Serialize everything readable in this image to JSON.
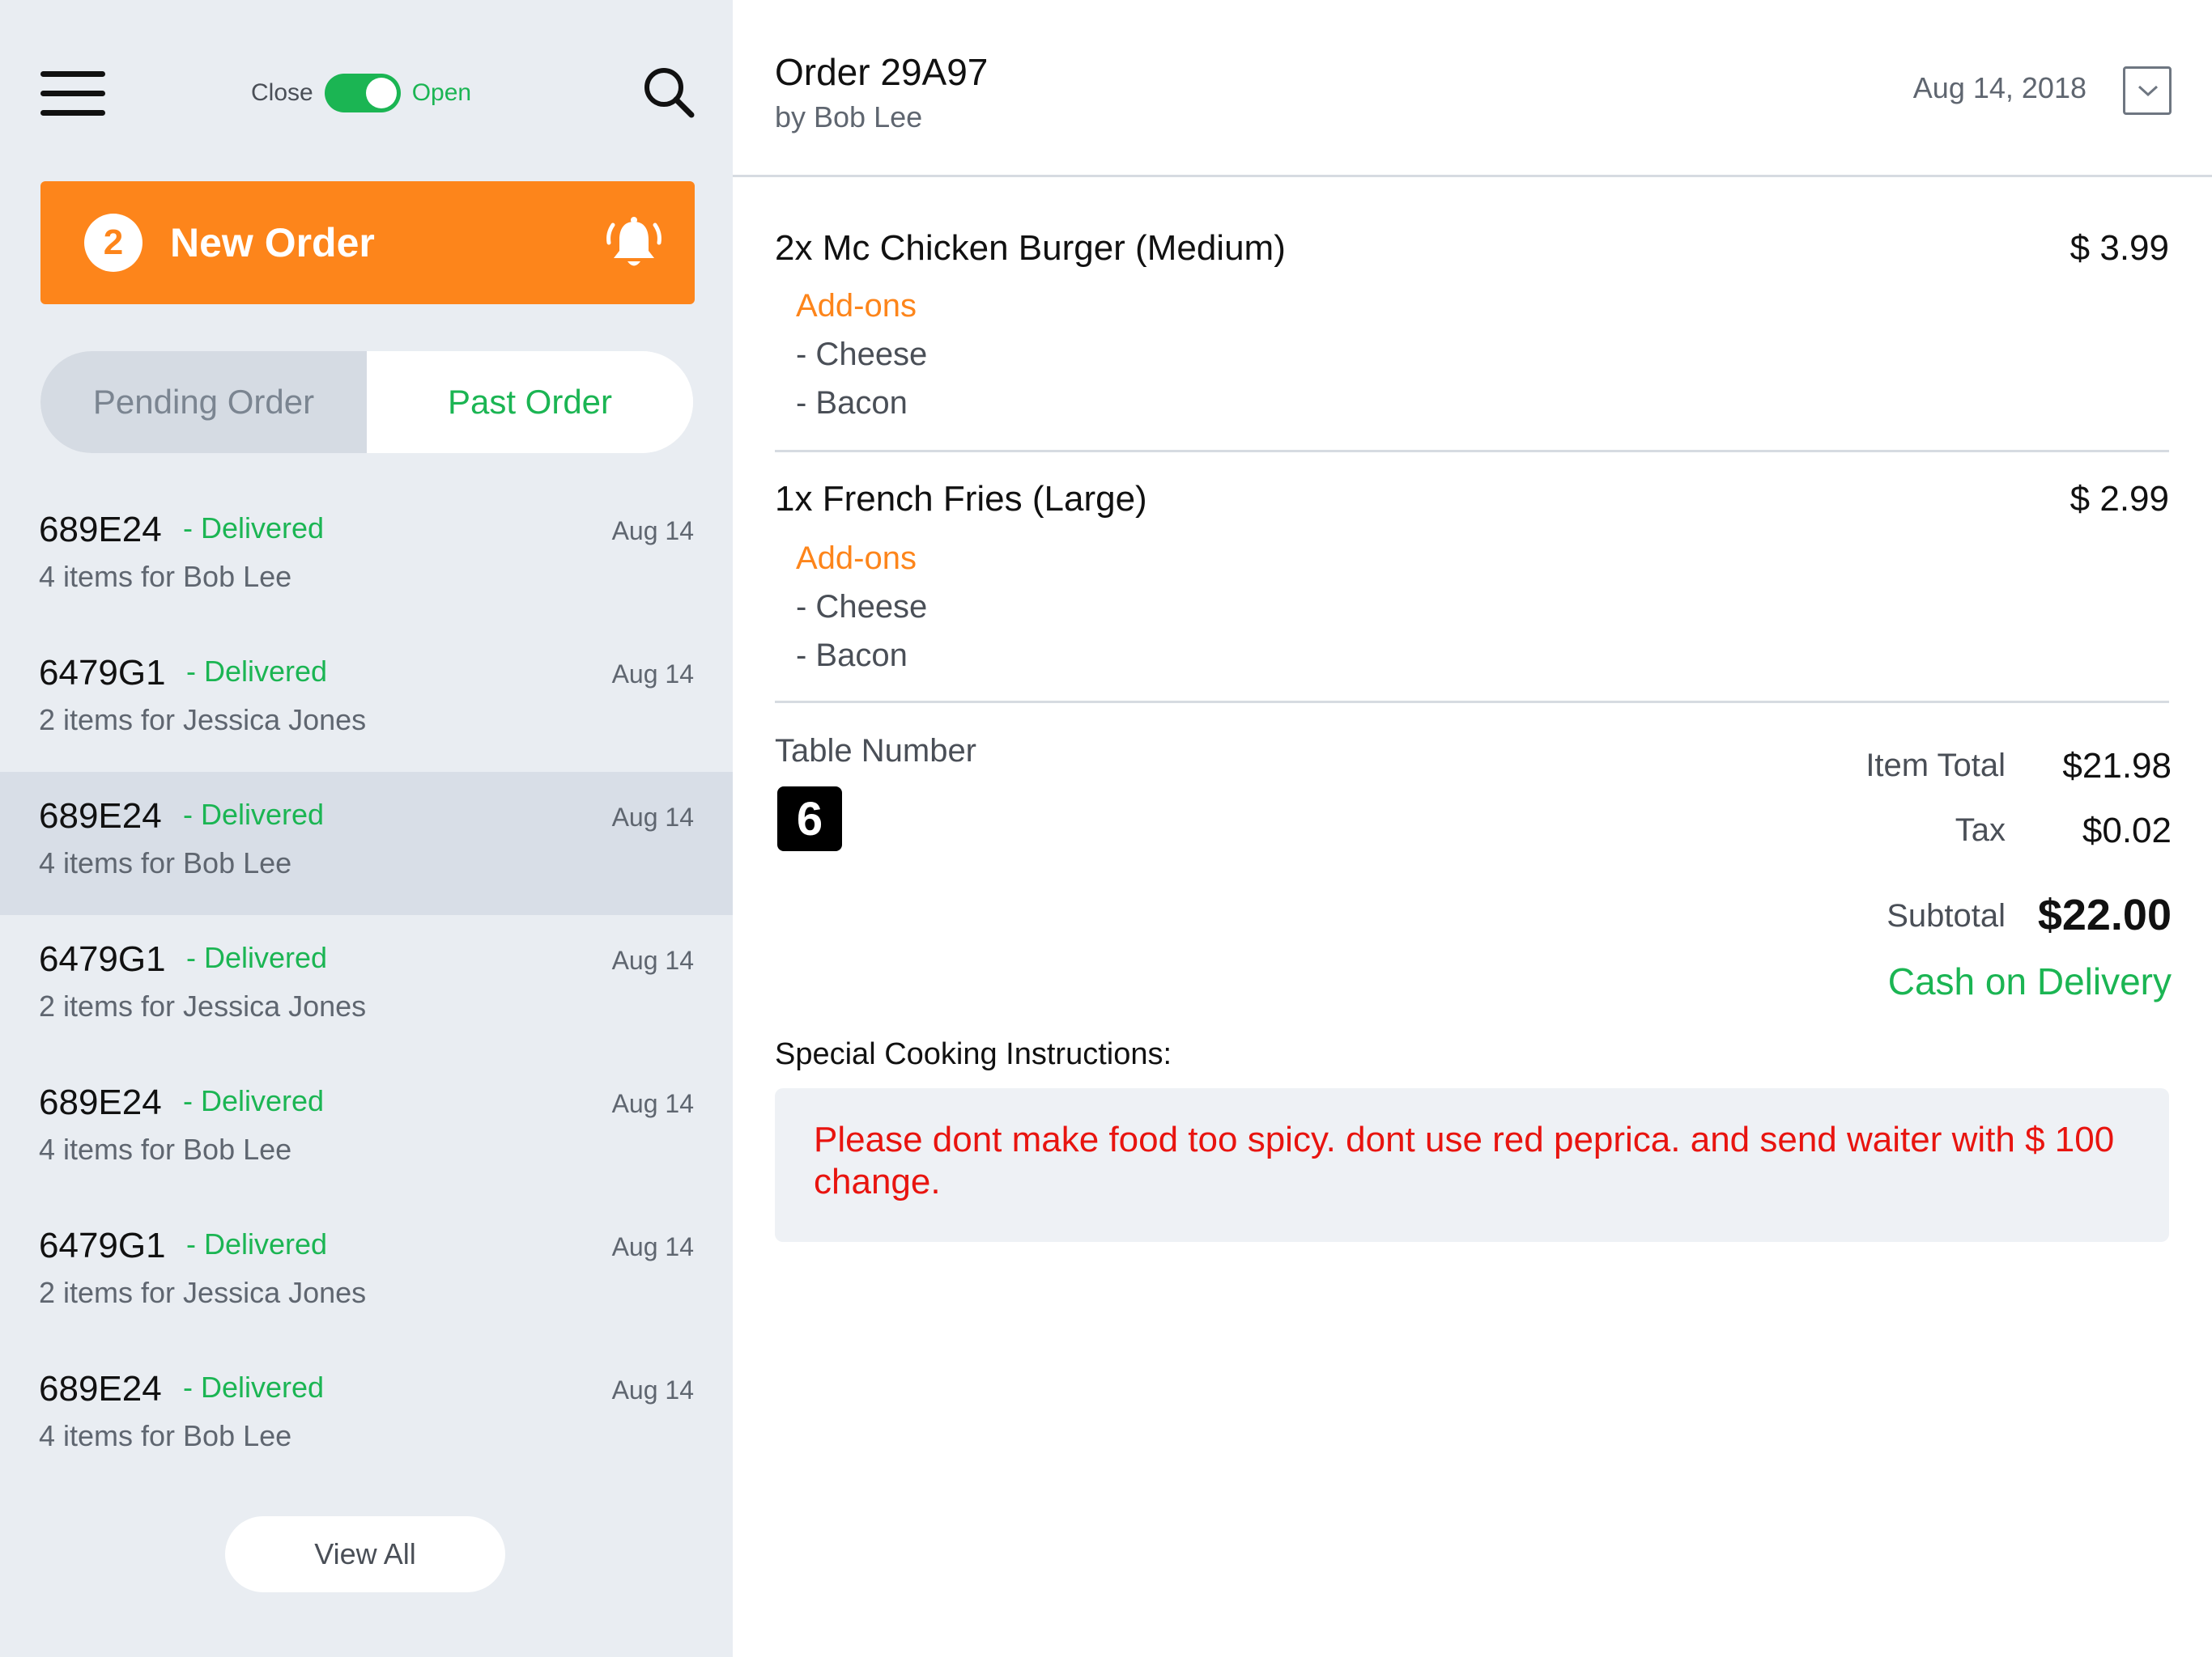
{
  "sidebar": {
    "store_toggle": {
      "close_label": "Close",
      "open_label": "Open",
      "state": "open"
    },
    "new_order": {
      "count": "2",
      "label": "New Order"
    },
    "tabs": [
      {
        "label": "Pending Order",
        "active": false
      },
      {
        "label": "Past Order",
        "active": true
      }
    ],
    "orders": [
      {
        "code": "689E24",
        "status": "- Delivered",
        "summary": "4 items for Bob Lee",
        "date": "Aug 14",
        "selected": false
      },
      {
        "code": "6479G1",
        "status": "- Delivered",
        "summary": "2 items for Jessica Jones",
        "date": "Aug 14",
        "selected": false
      },
      {
        "code": "689E24",
        "status": "- Delivered",
        "summary": "4 items for Bob Lee",
        "date": "Aug 14",
        "selected": true
      },
      {
        "code": "6479G1",
        "status": "- Delivered",
        "summary": "2 items for Jessica Jones",
        "date": "Aug 14",
        "selected": false
      },
      {
        "code": "689E24",
        "status": "- Delivered",
        "summary": "4 items for Bob Lee",
        "date": "Aug 14",
        "selected": false
      },
      {
        "code": "6479G1",
        "status": "- Delivered",
        "summary": "2 items for Jessica Jones",
        "date": "Aug 14",
        "selected": false
      },
      {
        "code": "689E24",
        "status": "- Delivered",
        "summary": "4 items for Bob Lee",
        "date": "Aug 14",
        "selected": false
      }
    ],
    "view_all_label": "View All"
  },
  "detail": {
    "title": "Order 29A97",
    "customer": "by Bob Lee",
    "date": "Aug 14, 2018",
    "items": [
      {
        "name": "2x Mc Chicken Burger (Medium)",
        "price": "$ 3.99",
        "addons_label": "Add-ons",
        "addons": [
          "- Cheese",
          "- Bacon"
        ]
      },
      {
        "name": "1x French Fries (Large)",
        "price": "$ 2.99",
        "addons_label": "Add-ons",
        "addons": [
          "- Cheese",
          "- Bacon"
        ]
      }
    ],
    "table_label": "Table Number",
    "table_number": "6",
    "summary": {
      "item_total_label": "Item Total",
      "item_total": "$21.98",
      "tax_label": "Tax",
      "tax": "$0.02",
      "subtotal_label": "Subtotal",
      "subtotal": "$22.00"
    },
    "payment_method": "Cash on Delivery",
    "instructions_label": "Special Cooking Instructions:",
    "instructions": "Please dont make food too spicy. dont use red peprica. and send waiter with $ 100 change."
  },
  "colors": {
    "accent_green": "#1bb553",
    "accent_orange": "#fd851b",
    "alert_red": "#e8140f",
    "sidebar_bg": "#e9edf2"
  },
  "icons": [
    "hamburger-menu-icon",
    "search-icon",
    "bell-icon",
    "chevron-down-icon"
  ]
}
